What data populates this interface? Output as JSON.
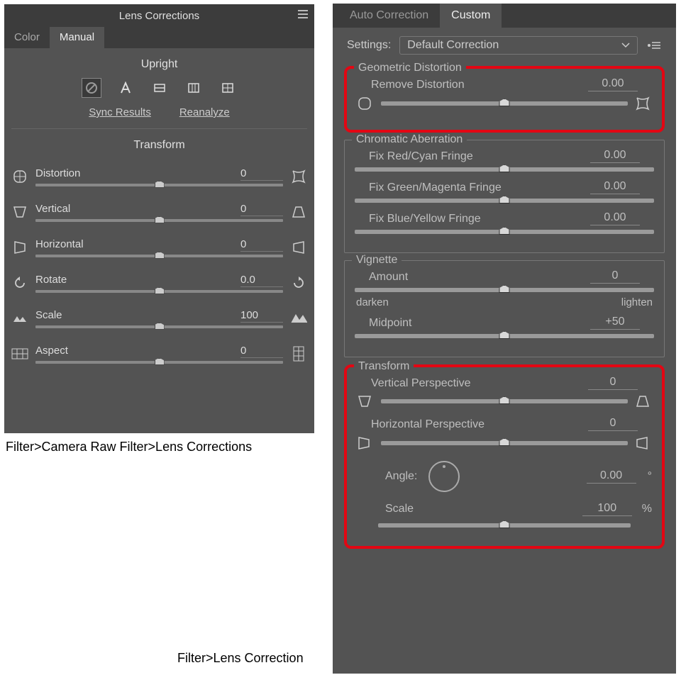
{
  "left": {
    "title": "Lens Corrections",
    "tabs": {
      "color": "Color",
      "manual": "Manual"
    },
    "upright_title": "Upright",
    "links": {
      "sync": "Sync Results",
      "reanalyze": "Reanalyze"
    },
    "transform_title": "Transform",
    "sliders": {
      "distortion": {
        "label": "Distortion",
        "value": "0"
      },
      "vertical": {
        "label": "Vertical",
        "value": "0"
      },
      "horizontal": {
        "label": "Horizontal",
        "value": "0"
      },
      "rotate": {
        "label": "Rotate",
        "value": "0.0"
      },
      "scale": {
        "label": "Scale",
        "value": "100"
      },
      "aspect": {
        "label": "Aspect",
        "value": "0"
      }
    },
    "caption": "Filter>Camera Raw Filter>Lens Corrections"
  },
  "right": {
    "tabs": {
      "auto": "Auto Correction",
      "custom": "Custom"
    },
    "settings_label": "Settings:",
    "settings_value": "Default Correction",
    "geometric": {
      "title": "Geometric Distortion",
      "remove": {
        "label": "Remove Distortion",
        "value": "0.00"
      }
    },
    "chromatic": {
      "title": "Chromatic Aberration",
      "red": {
        "label": "Fix Red/Cyan Fringe",
        "value": "0.00"
      },
      "green": {
        "label": "Fix Green/Magenta Fringe",
        "value": "0.00"
      },
      "blue": {
        "label": "Fix Blue/Yellow Fringe",
        "value": "0.00"
      }
    },
    "vignette": {
      "title": "Vignette",
      "amount": {
        "label": "Amount",
        "value": "0"
      },
      "darken": "darken",
      "lighten": "lighten",
      "midpoint": {
        "label": "Midpoint",
        "value": "+50"
      }
    },
    "transform": {
      "title": "Transform",
      "vert": {
        "label": "Vertical Perspective",
        "value": "0"
      },
      "horiz": {
        "label": "Horizontal Perspective",
        "value": "0"
      },
      "angle": {
        "label": "Angle:",
        "value": "0.00",
        "unit": "°"
      },
      "scale": {
        "label": "Scale",
        "value": "100",
        "unit": "%"
      }
    },
    "caption": "Filter>Lens Correction"
  }
}
